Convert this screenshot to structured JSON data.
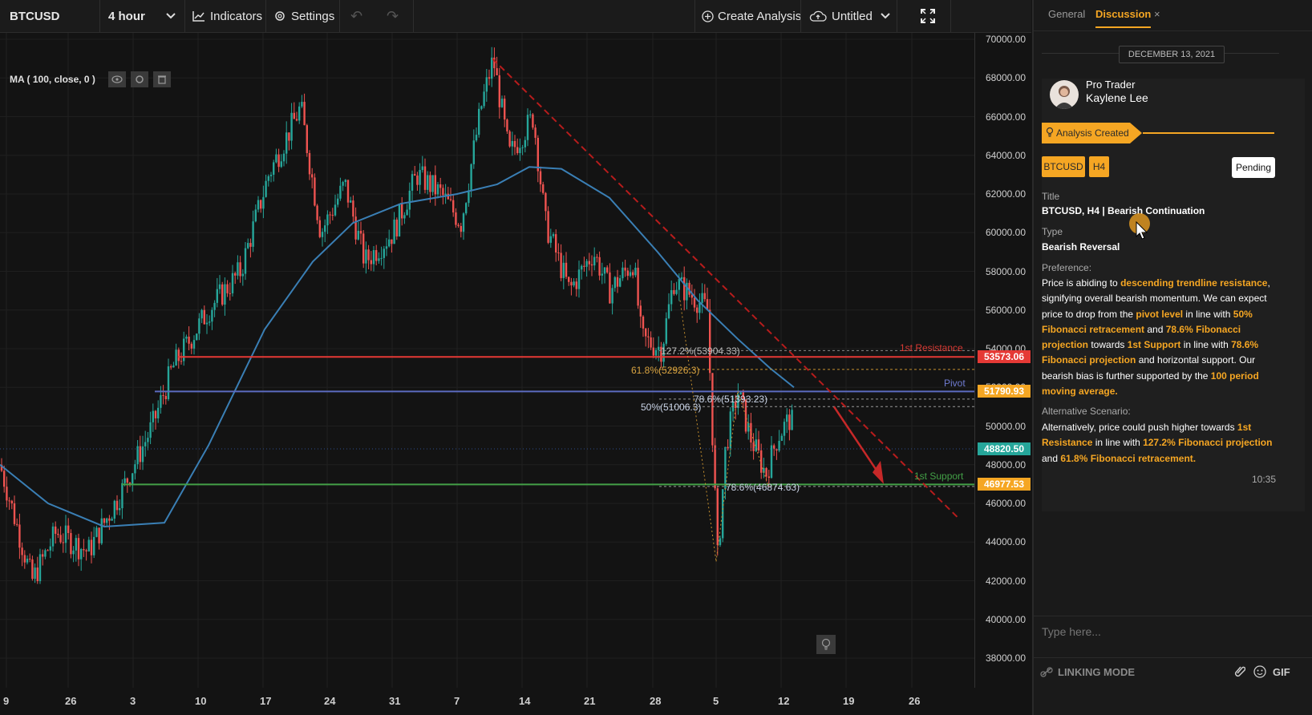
{
  "toolbar": {
    "symbol": "BTCUSD",
    "timeframe": "4 hour",
    "indicators": "Indicators",
    "settings": "Settings",
    "create_analysis": "Create Analysis",
    "untitled": "Untitled"
  },
  "indicator": {
    "label": "MA ( 100, close, 0 )"
  },
  "price_axis": [
    "70000.00",
    "68000.00",
    "66000.00",
    "64000.00",
    "62000.00",
    "60000.00",
    "58000.00",
    "56000.00",
    "54000.00",
    "53573.06",
    "51790.93",
    "50000.00",
    "48820.50",
    "48000.00",
    "46977.53",
    "46000.00",
    "44000.00",
    "42000.00",
    "40000.00",
    "38000.00"
  ],
  "price_axis_plain": [
    "70000.00",
    "68000.00",
    "66000.00",
    "64000.00",
    "62000.00",
    "60000.00",
    "58000.00",
    "56000.00",
    "54000.00",
    "52000.00",
    "50000.00",
    "48000.00",
    "46000.00",
    "44000.00",
    "42000.00",
    "40000.00",
    "38000.00"
  ],
  "price_tags": {
    "resistance": "53573.06",
    "pivot": "51790.93",
    "current": "48820.50",
    "support": "46977.53"
  },
  "date_axis": [
    "9",
    "26",
    "3",
    "10",
    "17",
    "24",
    "31",
    "7",
    "14",
    "21",
    "28",
    "5",
    "12",
    "19",
    "26"
  ],
  "annotations": {
    "resistance": "1st Resistance",
    "pivot": "Pivot",
    "support": "1st Support",
    "fib_1272": "127.2%(53904.33)",
    "fib_618": "61.8%(52926.3)",
    "fib_786_top": "78.6%(51393.23)",
    "fib_50": "50%(51006.3)",
    "fib_786_bottom": "78.6%(46874.63)"
  },
  "colors": {
    "bull": "#26a69a",
    "bear": "#ef5350",
    "ma": "#3a7fb5",
    "resistance": "#e53935",
    "pivot": "#5c6bc0",
    "support": "#43a047",
    "accent": "#f5a623"
  },
  "panel": {
    "tab_general": "General",
    "tab_discussion": "Discussion",
    "date": "DECEMBER 13, 2021",
    "author_role": "Pro Trader",
    "author_name": "Kaylene Lee",
    "banner": "Analysis Created",
    "badge_symbol": "BTCUSD",
    "badge_tf": "H4",
    "status": "Pending",
    "title_label": "Title",
    "title_value": "BTCUSD, H4 | Bearish Continuation",
    "type_label": "Type",
    "type_value": "Bearish Reversal",
    "pref_label": "Preference:",
    "pref_parts": [
      {
        "t": "Price is abiding to ",
        "h": false
      },
      {
        "t": "descending trendline resistance",
        "h": true
      },
      {
        "t": ", signifying overall bearish momentum. We can expect price to drop from the ",
        "h": false
      },
      {
        "t": "pivot level",
        "h": true
      },
      {
        "t": " in line with ",
        "h": false
      },
      {
        "t": "50% Fibonacci retracement",
        "h": true
      },
      {
        "t": " and ",
        "h": false
      },
      {
        "t": "78.6% Fibonacci projection",
        "h": true
      },
      {
        "t": " towards ",
        "h": false
      },
      {
        "t": "1st Support",
        "h": true
      },
      {
        "t": " in line with ",
        "h": false
      },
      {
        "t": "78.6% Fibonacci projection",
        "h": true
      },
      {
        "t": " and horizontal support. Our bearish bias is further supported by the ",
        "h": false
      },
      {
        "t": "100 period moving average.",
        "h": true
      }
    ],
    "alt_label": "Alternative Scenario:",
    "alt_parts": [
      {
        "t": "Alternatively, price could push higher towards ",
        "h": false
      },
      {
        "t": "1st Resistance",
        "h": true
      },
      {
        "t": " in line with ",
        "h": false
      },
      {
        "t": "127.2% Fibonacci projection",
        "h": true
      },
      {
        "t": " and ",
        "h": false
      },
      {
        "t": "61.8% Fibonacci retracement.",
        "h": true
      }
    ],
    "time": "10:35",
    "input_placeholder": "Type here...",
    "linking_mode": "LINKING MODE",
    "gif": "GIF"
  }
}
